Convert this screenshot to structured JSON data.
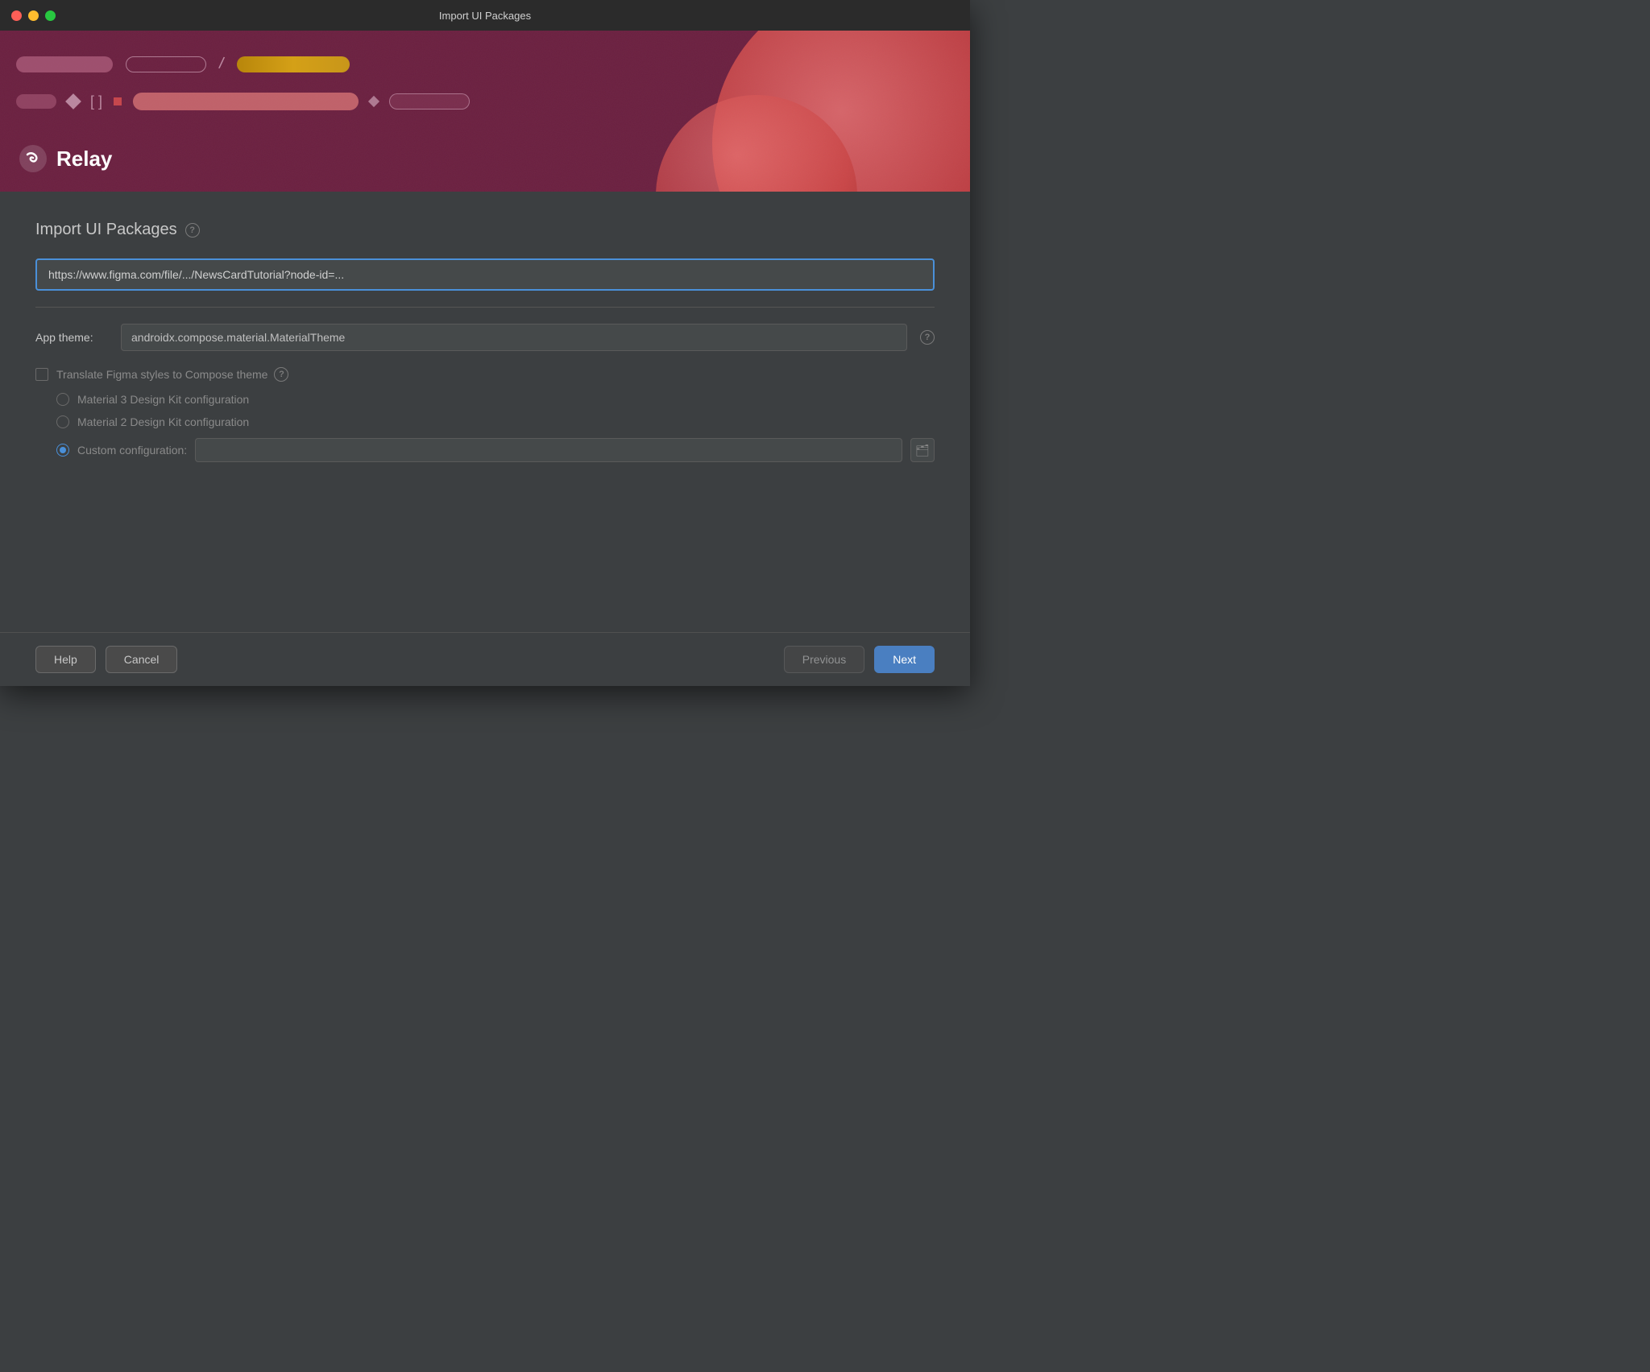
{
  "window": {
    "title": "Import UI Packages"
  },
  "hero": {
    "logo_text": "Relay"
  },
  "main": {
    "title": "Import UI Packages",
    "help_icon_label": "?",
    "url_input": {
      "value": "https://www.figma.com/file/.../NewsCardTutorial?node-id=...",
      "placeholder": "https://www.figma.com/file/.../NewsCardTutorial?node-id=..."
    },
    "app_theme_label": "App theme:",
    "app_theme_value": "androidx.compose.material.MaterialTheme",
    "theme_help_icon_label": "?",
    "translate_checkbox_label": "Translate Figma styles to Compose theme",
    "translate_help_icon_label": "?",
    "radio_options": [
      {
        "id": "material3",
        "label": "Material 3 Design Kit configuration",
        "selected": false
      },
      {
        "id": "material2",
        "label": "Material 2 Design Kit configuration",
        "selected": false
      },
      {
        "id": "custom",
        "label": "Custom configuration:",
        "selected": true
      }
    ],
    "custom_config_placeholder": ""
  },
  "footer": {
    "help_label": "Help",
    "cancel_label": "Cancel",
    "previous_label": "Previous",
    "next_label": "Next"
  }
}
